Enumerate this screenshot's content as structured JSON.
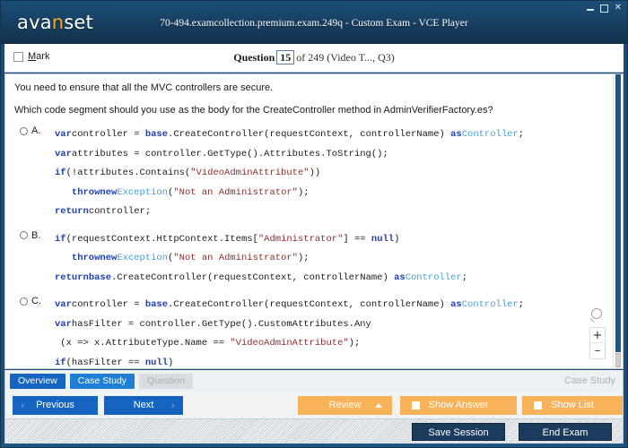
{
  "window": {
    "title": "70-494.examcollection.premium.exam.249q - Custom Exam - VCE Player",
    "logo_text_1": "ava",
    "logo_accent": "n",
    "logo_text_2": "set",
    "minimize_icon": "minimize-icon",
    "maximize_icon": "maximize-icon",
    "close_icon": "close-icon",
    "close_glyph": "✕"
  },
  "question_header": {
    "mark_label_first": "M",
    "mark_label_rest": "ark",
    "question_word": "Question",
    "question_number": "15",
    "of_text": "of 249 (Video T..., Q3)"
  },
  "question": {
    "line1": "You need to ensure that all the MVC controllers are secure.",
    "line2": "Which code segment should you use as the body for the CreateController method in AdminVerifierFactory.es?"
  },
  "options": [
    {
      "letter": "A.",
      "code_lines": [
        [
          {
            "t": "var",
            "c": "kw"
          },
          {
            "t": "controller = ",
            "c": "plain"
          },
          {
            "t": "base",
            "c": "kw"
          },
          {
            "t": ".CreateController(requestContext, controllerName) ",
            "c": "plain"
          },
          {
            "t": "as",
            "c": "kw"
          },
          {
            "t": "Controller",
            "c": "typ"
          },
          {
            "t": ";",
            "c": "plain"
          }
        ],
        [
          {
            "t": "var",
            "c": "kw"
          },
          {
            "t": "attributes = controller.GetType().Attributes.ToString();",
            "c": "plain"
          }
        ],
        [
          {
            "t": "if",
            "c": "kw"
          },
          {
            "t": "(!attributes.Contains(",
            "c": "plain"
          },
          {
            "t": "\"VideoAdminAttribute\"",
            "c": "str"
          },
          {
            "t": "))",
            "c": "plain"
          }
        ],
        [
          {
            "t": "   ",
            "c": "plain"
          },
          {
            "t": "throw",
            "c": "kw"
          },
          {
            "t": "new",
            "c": "kw"
          },
          {
            "t": "Exception",
            "c": "typ"
          },
          {
            "t": "(",
            "c": "plain"
          },
          {
            "t": "\"Not an Administrator\"",
            "c": "str"
          },
          {
            "t": ");",
            "c": "plain"
          }
        ],
        [
          {
            "t": "return",
            "c": "kw"
          },
          {
            "t": "controller;",
            "c": "plain"
          }
        ]
      ]
    },
    {
      "letter": "B.",
      "code_lines": [
        [
          {
            "t": "if",
            "c": "kw"
          },
          {
            "t": "(requestContext.HttpContext.Items[",
            "c": "plain"
          },
          {
            "t": "\"Administrator\"",
            "c": "str"
          },
          {
            "t": "] == ",
            "c": "plain"
          },
          {
            "t": "null",
            "c": "kw"
          },
          {
            "t": ")",
            "c": "plain"
          }
        ],
        [
          {
            "t": "   ",
            "c": "plain"
          },
          {
            "t": "throw",
            "c": "kw"
          },
          {
            "t": "new",
            "c": "kw"
          },
          {
            "t": "Exception",
            "c": "typ"
          },
          {
            "t": "(",
            "c": "plain"
          },
          {
            "t": "\"Not an Administrator\"",
            "c": "str"
          },
          {
            "t": ");",
            "c": "plain"
          }
        ],
        [
          {
            "t": "return",
            "c": "kw"
          },
          {
            "t": "base",
            "c": "kw"
          },
          {
            "t": ".CreateController(requestContext, controllerName) ",
            "c": "plain"
          },
          {
            "t": "as",
            "c": "kw"
          },
          {
            "t": "Controller",
            "c": "typ"
          },
          {
            "t": ";",
            "c": "plain"
          }
        ]
      ]
    },
    {
      "letter": "C.",
      "code_lines": [
        [
          {
            "t": "var",
            "c": "kw"
          },
          {
            "t": "controller = ",
            "c": "plain"
          },
          {
            "t": "base",
            "c": "kw"
          },
          {
            "t": ".CreateController(requestContext, controllerName) ",
            "c": "plain"
          },
          {
            "t": "as",
            "c": "kw"
          },
          {
            "t": "Controller",
            "c": "typ"
          },
          {
            "t": ";",
            "c": "plain"
          }
        ],
        [
          {
            "t": "var",
            "c": "kw"
          },
          {
            "t": "hasFilter = controller.GetType().CustomAttributes.Any",
            "c": "plain"
          }
        ],
        [
          {
            "t": " (x => x.AttributeType.Name == ",
            "c": "plain"
          },
          {
            "t": "\"VideoAdminAttribute\"",
            "c": "str"
          },
          {
            "t": ");",
            "c": "plain"
          }
        ],
        [
          {
            "t": "if",
            "c": "kw"
          },
          {
            "t": "(hasFilter == ",
            "c": "plain"
          },
          {
            "t": "null",
            "c": "kw"
          },
          {
            "t": ")",
            "c": "plain"
          }
        ]
      ]
    }
  ],
  "zoom_widget": {
    "magnifier_icon": "magnifier-icon",
    "zoom_in_label": "+",
    "zoom_out_label": "–"
  },
  "tabs": [
    {
      "label": "Overview",
      "state": "primary"
    },
    {
      "label": "Case Study",
      "state": "secondary"
    },
    {
      "label": "Question",
      "state": "disabled"
    }
  ],
  "tab_right_label": "Case Study",
  "actions": {
    "previous": "Previous",
    "next": "Next",
    "review": "Review",
    "show_answer": "Show Answer",
    "show_list": "Show List",
    "chevron_left": "‹",
    "chevron_right": "›"
  },
  "footer": {
    "save_session": "Save Session",
    "end_exam": "End Exam"
  },
  "colors": {
    "header_navy": "#173e60",
    "brand_orange": "#f5a623",
    "tab_blue": "#1565c0",
    "button_orange": "#f8b259",
    "footer_dark": "#1b3a5c"
  }
}
